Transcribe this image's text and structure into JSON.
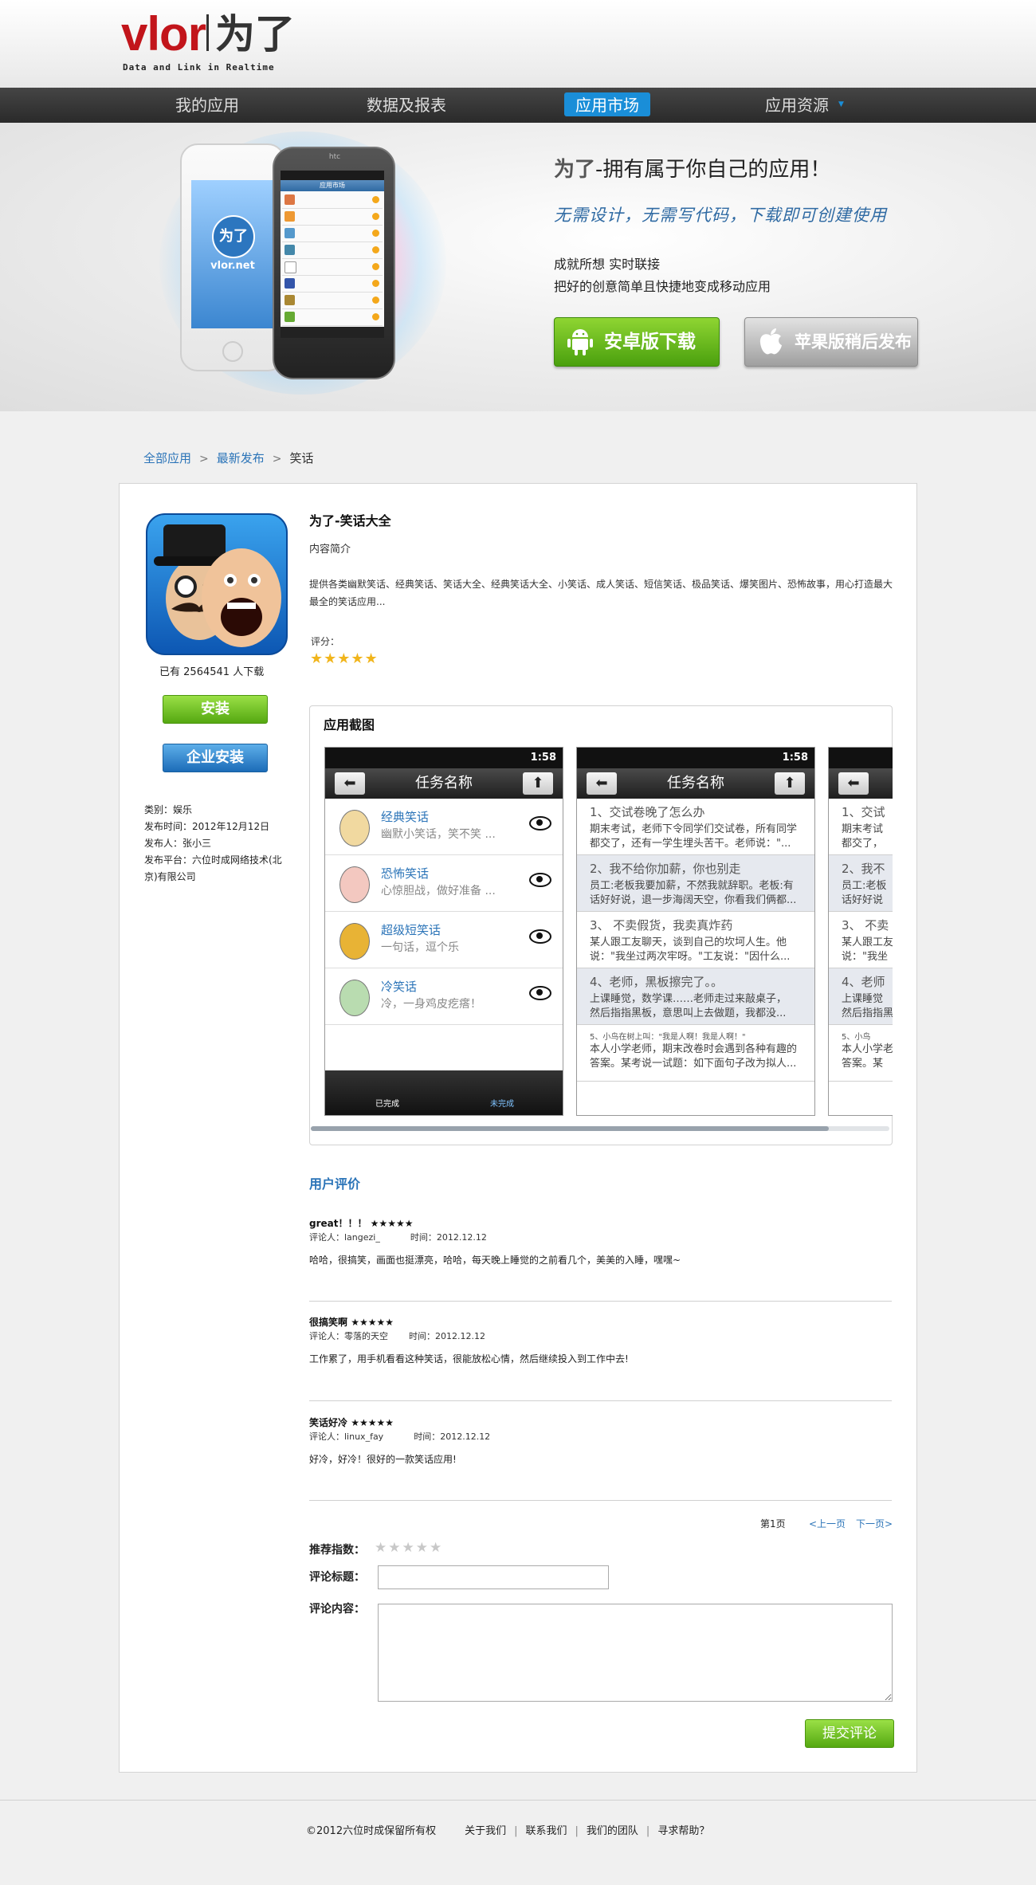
{
  "header": {
    "logo_brand": "vlor",
    "logo_cn": "为了",
    "logo_tagline": "Data and Link in Realtime",
    "nav": [
      "我的应用",
      "数据及报表",
      "应用市场",
      "应用资源"
    ],
    "nav_active": "应用市场"
  },
  "banner": {
    "phone_brand": "htc",
    "phone_screen_title": "应用市场",
    "iphone_logo": "为了",
    "iphone_brand": "vlor.net",
    "title_brand": "为了",
    "title_rest": "-拥有属于你自己的应用！",
    "slogan": "无需设计，无需写代码，下载即可创建使用",
    "line1": "成就所想  实时联接",
    "line2": "把好的创意简单且快捷地变成移动应用",
    "android_button": "安卓版下载",
    "apple_button": "苹果版稍后发布"
  },
  "breadcrumb": [
    "全部应用",
    "最新发布",
    "笑话"
  ],
  "app": {
    "name": "为了-笑话大全",
    "downloads_prefix": "已有",
    "downloads": "2564541",
    "downloads_suffix": "人下载",
    "install_button": "安装",
    "enterprise_button": "企业安装",
    "category": "类别：娱乐",
    "published": "发布时间：2012年12月12日",
    "publisher": "发布人：张小三",
    "platform_1": "发布平台：六位时成网络技术(北",
    "platform_2": "京)有限公司",
    "intro_label": "内容简介",
    "intro_text": "提供各类幽默笑话、经典笑话、笑话大全、经典笑话大全、小笑话、成人笑话、短信笑话、极品笑话、爆笑图片、恐怖故事，用心打造最大最全的笑话应用...",
    "rating_label": "评分：",
    "rating": 5,
    "rating_stars": "★★★★★"
  },
  "screenshots": {
    "title": "应用截图",
    "status_time": "1:58",
    "nav_title": "任务名称",
    "phone1_items": [
      {
        "title": "经典笑话",
        "sub": "幽默小笑话，笑不笑 ..."
      },
      {
        "title": "恐怖笑话",
        "sub": "心惊胆战，做好准备 ..."
      },
      {
        "title": "超级短笑话",
        "sub": "一句话，逗个乐"
      },
      {
        "title": "冷笑话",
        "sub": "冷，一身鸡皮疙瘩！"
      }
    ],
    "phone1_tabs": [
      "已完成",
      "未完成"
    ],
    "phone2_items": [
      {
        "title": "1、交试卷晚了怎么办",
        "sub1": "期末考试，老师下令同学们交试卷，所有同学",
        "sub2": "都交了，还有一学生埋头苦干。老师说：\"..."
      },
      {
        "title": "2、我不给你加薪，你也别走",
        "sub1": "员工:老板我要加薪，不然我就辞职。老板:有",
        "sub2": "话好好说，退一步海阔天空，你看我们俩都..."
      },
      {
        "title": "3、 不卖假货，我卖真炸药",
        "sub1": "某人跟工友聊天，谈到自己的坎坷人生。他",
        "sub2": "说：\"我坐过两次牢呀。\"工友说：\"因什么..."
      },
      {
        "title": "4、老师，黑板擦完了。。",
        "sub1": "上课睡觉，数学课……老师走过来敲桌子，",
        "sub2": "然后指指黑板，意思叫上去做题，我都没..."
      },
      {
        "title": "5、小鸟在树上叫：\"我是人啊！我是人啊！\"",
        "sub1": "本人小学老师，期末改卷时会遇到各种有趣的",
        "sub2": "答案。某考说一试题：如下面句子改为拟人..."
      }
    ],
    "phone3_items": [
      {
        "title": "1、交试",
        "sub1": "期末考试",
        "sub2": "都交了，"
      },
      {
        "title": "2、我不",
        "sub1": "员工:老板",
        "sub2": "话好好说"
      },
      {
        "title": "3、 不卖",
        "sub1": "某人跟工友",
        "sub2": "说：\"我坐"
      },
      {
        "title": "4、老师",
        "sub1": "上课睡觉",
        "sub2": "然后指指黑"
      },
      {
        "title": "5、小鸟",
        "sub1": "本人小学老",
        "sub2": "答案。某"
      }
    ]
  },
  "reviews": {
    "title": "用户评价",
    "items": [
      {
        "headline": "great！！！",
        "stars": "★★★★★",
        "author_label": "评论人：",
        "author": "langezi_",
        "time_label": "时间：",
        "time": "2012.12.12",
        "body": "哈哈，很搞笑，画面也挺漂亮，哈哈，每天晚上睡觉的之前看几个，美美的入睡，嘿嘿~"
      },
      {
        "headline": "很搞笑啊",
        "stars": "★★★★★",
        "author_label": "评论人：",
        "author": "零落的天空",
        "time_label": "时间：",
        "time": "2012.12.12",
        "body": "工作累了，用手机看看这种笑话，很能放松心情，然后继续投入到工作中去!"
      },
      {
        "headline": "笑话好冷",
        "stars": "★★★★★",
        "author_label": "评论人：",
        "author": "linux_fay",
        "time_label": "时间：",
        "time": "2012.12.12",
        "body": "好冷，好冷！很好的一款笑话应用!"
      }
    ],
    "page": "第1页",
    "prev": "<上一页",
    "next": "下一页>"
  },
  "form": {
    "score_label": "推荐指数：",
    "score_stars": "★★★★★",
    "title_label": "评论标题：",
    "title_value": "",
    "content_label": "评论内容：",
    "content_value": "",
    "submit": "提交评论"
  },
  "footer": {
    "copyright": "©2012六位时成保留所有权",
    "links": [
      "关于我们",
      "联系我们",
      "我们的团队",
      "寻求帮助？"
    ]
  },
  "colors": {
    "nav_active": "#1a8ed8",
    "link": "#2b74b8",
    "brand_red": "#c2151b",
    "install_green": "#6cbd1e",
    "star_gold": "#f1b51c"
  }
}
